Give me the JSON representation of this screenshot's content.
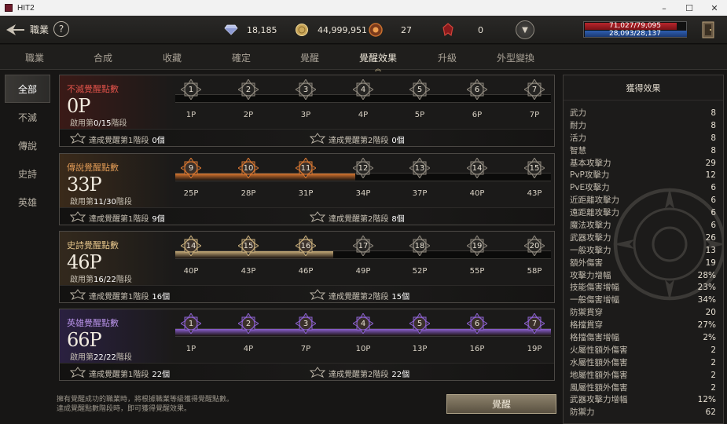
{
  "window": {
    "title": "HIT2",
    "minimize": "–",
    "maximize": "☐",
    "close": "✕"
  },
  "topbar": {
    "job_label": "職業",
    "help": "?",
    "currencies": [
      {
        "icon": "diamond-icon",
        "value": "18,185"
      },
      {
        "icon": "gold-coin-icon",
        "value": "44,999,951"
      },
      {
        "icon": "crest-token-icon",
        "value": "27"
      },
      {
        "icon": "red-emblem-icon",
        "value": "0"
      }
    ],
    "dropdown": "▼",
    "hp": "71,027/79,095",
    "mp": "28,093/28,137",
    "hp_fraction": 0.898,
    "mp_fraction": 0.998
  },
  "tabs": [
    "職業",
    "合成",
    "收藏",
    "確定",
    "覺醒",
    "覺醒效果",
    "升級",
    "外型變換"
  ],
  "active_tab": "覺醒效果",
  "tab_marker": "︽",
  "leftnav": [
    "全部",
    "不滅",
    "傳說",
    "史詩",
    "英雄"
  ],
  "cards": [
    {
      "label": "不滅覺醒點數",
      "label_color": "#e0524a",
      "points": "0P",
      "stage_prefix": "啟用第",
      "stage_value": "0/15",
      "stage_suffix": "階段",
      "fill_fraction": 0,
      "fill_color": "#8a2b22",
      "nodes": [
        "1",
        "2",
        "3",
        "4",
        "5",
        "6",
        "7"
      ],
      "reqs": [
        "1P",
        "2P",
        "3P",
        "4P",
        "5P",
        "6P",
        "7P"
      ],
      "ach1": "達成覺醒第1階段",
      "ach1_val": "0個",
      "ach2": "達成覺醒第2階段",
      "ach2_val": "0個",
      "bg": "#3a1a17"
    },
    {
      "label": "傳說覺醒點數",
      "label_color": "#e09a55",
      "points": "33P",
      "stage_prefix": "啟用第",
      "stage_value": "11/30",
      "stage_suffix": "階段",
      "fill_fraction": 0.48,
      "fill_color": "#d9762f",
      "nodes": [
        "9",
        "10",
        "11",
        "12",
        "13",
        "14",
        "15"
      ],
      "reqs": [
        "25P",
        "28P",
        "31P",
        "34P",
        "37P",
        "40P",
        "43P"
      ],
      "ach1": "達成覺醒第1階段",
      "ach1_val": "9個",
      "ach2": "達成覺醒第2階段",
      "ach2_val": "8個",
      "bg": "#3a2a1a"
    },
    {
      "label": "史詩覺醒點數",
      "label_color": "#e4c48a",
      "points": "46P",
      "stage_prefix": "啟用第",
      "stage_value": "16/22",
      "stage_suffix": "階段",
      "fill_fraction": 0.42,
      "fill_color": "#c8ad7a",
      "nodes": [
        "14",
        "15",
        "16",
        "17",
        "18",
        "19",
        "20"
      ],
      "reqs": [
        "40P",
        "43P",
        "46P",
        "49P",
        "52P",
        "55P",
        "58P"
      ],
      "ach1": "達成覺醒第1階段",
      "ach1_val": "16個",
      "ach2": "達成覺醒第2階段",
      "ach2_val": "15個",
      "bg": "#33291d"
    },
    {
      "label": "英雄覺醒點數",
      "label_color": "#b892e8",
      "points": "66P",
      "stage_prefix": "啟用第",
      "stage_value": "22/22",
      "stage_suffix": "階段",
      "fill_fraction": 1.0,
      "fill_color": "#8b5fd0",
      "nodes": [
        "1",
        "2",
        "3",
        "4",
        "5",
        "6",
        "7"
      ],
      "reqs": [
        "1P",
        "4P",
        "7P",
        "10P",
        "13P",
        "16P",
        "19P"
      ],
      "ach1": "達成覺醒第1階段",
      "ach1_val": "22個",
      "ach2": "達成覺醒第2階段",
      "ach2_val": "22個",
      "bg": "#2a2040"
    }
  ],
  "hint_line1": "擁有覺醒成功的職業時，將根據職業等級獲得覺醒點數。",
  "hint_line2": "達成覺醒點數階段時，即可獲得覺醒效果。",
  "awaken_button": "覺醒",
  "effects": {
    "title": "獲得效果",
    "rows": [
      {
        "name": "武力",
        "value": "8"
      },
      {
        "name": "耐力",
        "value": "8"
      },
      {
        "name": "活力",
        "value": "8"
      },
      {
        "name": "智慧",
        "value": "8"
      },
      {
        "name": "基本攻擊力",
        "value": "29"
      },
      {
        "name": "PvP攻擊力",
        "value": "12"
      },
      {
        "name": "PvE攻擊力",
        "value": "6"
      },
      {
        "name": "近距離攻擊力",
        "value": "6"
      },
      {
        "name": "遠距離攻擊力",
        "value": "6"
      },
      {
        "name": "魔法攻擊力",
        "value": "6"
      },
      {
        "name": "武器攻擊力",
        "value": "26"
      },
      {
        "name": "一般攻擊力",
        "value": "13"
      },
      {
        "name": "額外傷害",
        "value": "19"
      },
      {
        "name": "攻擊力增幅",
        "value": "28%"
      },
      {
        "name": "技能傷害增幅",
        "value": "23%"
      },
      {
        "name": "一般傷害增幅",
        "value": "34%"
      },
      {
        "name": "防禦貫穿",
        "value": "20"
      },
      {
        "name": "格擋貫穿",
        "value": "27%"
      },
      {
        "name": "格擋傷害增幅",
        "value": "2%"
      },
      {
        "name": "火屬性額外傷害",
        "value": "2"
      },
      {
        "name": "水屬性額外傷害",
        "value": "2"
      },
      {
        "name": "地屬性額外傷害",
        "value": "2"
      },
      {
        "name": "風屬性額外傷害",
        "value": "2"
      },
      {
        "name": "武器攻擊力增幅",
        "value": "12%"
      },
      {
        "name": "防禦力",
        "value": "62"
      }
    ]
  }
}
